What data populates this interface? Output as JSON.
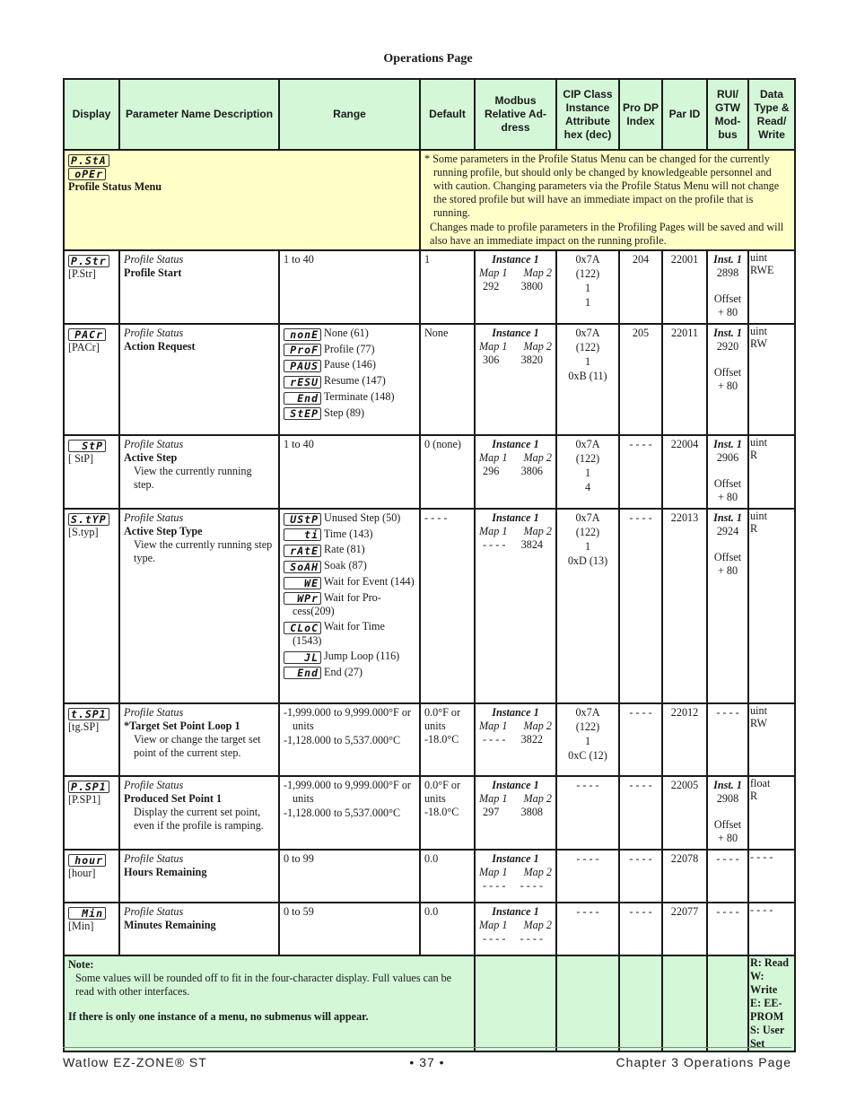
{
  "page_title": "Operations Page",
  "columns": [
    "Display",
    "Parameter Name Description",
    "Range",
    "Default",
    "Modbus Relative Ad-dress",
    "CIP Class Instance Attribute hex (dec)",
    "Pro DP Index",
    "Par ID",
    "RUI/ GTW Mod-bus",
    "Data Type & Read/ Write"
  ],
  "menu": {
    "lcd1": "P.StA",
    "lcd2": "oPEr",
    "name": "Profile Status Menu",
    "note1": "* Some parameters in the Profile Status Menu can be changed for the currently running profile, but should only be changed by knowledgeable personnel and with caution. Changing parameters via the Profile Status Menu will not change the stored profile but will have an immediate impact on the profile that is running.",
    "note2": "Changes made to profile parameters in the Profiling Pages will be saved and will also have an immediate impact on the running profile."
  },
  "rows": [
    {
      "lcd": "P.Str",
      "abbr": "[P.Str]",
      "group": "Profile Status",
      "name": "Profile Start",
      "desc": "",
      "range": [
        "1 to 40"
      ],
      "options": [],
      "default": "1",
      "modbus": {
        "instance": "Instance 1",
        "map1_label": "Map 1",
        "map2_label": "Map 2",
        "map1": "292",
        "map2": "3800"
      },
      "cip": [
        "0x7A",
        "(122)",
        "1",
        "1"
      ],
      "prodp": "204",
      "parid": "22001",
      "rui": {
        "inst": "Inst. 1",
        "value": "2898",
        "offset1": "Offset",
        "offset2": "+ 80"
      },
      "dtype": "uint",
      "rw": "RWE"
    },
    {
      "lcd": "PACr",
      "abbr": "[PACr]",
      "group": "Profile Status",
      "name": "Action Request",
      "desc": "",
      "range": [],
      "options": [
        {
          "lcd": "nonE",
          "label": "None (61)"
        },
        {
          "lcd": "ProF",
          "label": "Profile (77)"
        },
        {
          "lcd": "PAUS",
          "label": "Pause (146)"
        },
        {
          "lcd": "rESU",
          "label": "Resume (147)"
        },
        {
          "lcd": "End",
          "label": "Terminate (148)"
        },
        {
          "lcd": "StEP",
          "label": "Step (89)"
        }
      ],
      "default": "None",
      "modbus": {
        "instance": "Instance 1",
        "map1_label": "Map 1",
        "map2_label": "Map 2",
        "map1": "306",
        "map2": "3820"
      },
      "cip": [
        "0x7A",
        "(122)",
        "1",
        "0xB (11)"
      ],
      "prodp": "205",
      "parid": "22011",
      "rui": {
        "inst": "Inst. 1",
        "value": "2920",
        "offset1": "Offset",
        "offset2": "+ 80"
      },
      "dtype": "uint",
      "rw": "RW"
    },
    {
      "lcd": "StP",
      "abbr": "[ StP]",
      "group": "Profile Status",
      "name": "Active Step",
      "desc": "View the currently running step.",
      "range": [
        "1 to 40"
      ],
      "options": [],
      "default": "0 (none)",
      "modbus": {
        "instance": "Instance 1",
        "map1_label": "Map 1",
        "map2_label": "Map 2",
        "map1": "296",
        "map2": "3806"
      },
      "cip": [
        "0x7A",
        "(122)",
        "1",
        "4"
      ],
      "prodp": "- - - -",
      "parid": "22004",
      "rui": {
        "inst": "Inst. 1",
        "value": "2906",
        "offset1": "Offset",
        "offset2": "+ 80"
      },
      "dtype": "uint",
      "rw": "R"
    },
    {
      "lcd": "S.tYP",
      "abbr": "[S.typ]",
      "group": "Profile Status",
      "name": "Active Step Type",
      "desc": "View the currently running step type.",
      "range": [],
      "options": [
        {
          "lcd": "UStP",
          "label": "Unused Step (50)"
        },
        {
          "lcd": "ti",
          "label": "Time (143)"
        },
        {
          "lcd": "rAtE",
          "label": "Rate (81)"
        },
        {
          "lcd": "SoAH",
          "label": "Soak (87)"
        },
        {
          "lcd": "WE",
          "label": "Wait for Event (144)"
        },
        {
          "lcd": "WPr",
          "label": "Wait for Pro-cess(209)"
        },
        {
          "lcd": "CLoC",
          "label": "Wait for Time (1543)"
        },
        {
          "lcd": "JL",
          "label": "Jump Loop (116)"
        },
        {
          "lcd": "End",
          "label": "End (27)"
        }
      ],
      "default": "- - - -",
      "modbus": {
        "instance": "Instance 1",
        "map1_label": "Map 1",
        "map2_label": "Map 2",
        "map1": "- - - -",
        "map2": "3824"
      },
      "cip": [
        "0x7A",
        "(122)",
        "1",
        "0xD (13)"
      ],
      "prodp": "- - - -",
      "parid": "22013",
      "rui": {
        "inst": "Inst. 1",
        "value": "2924",
        "offset1": "Offset",
        "offset2": "+ 80"
      },
      "dtype": "uint",
      "rw": "R"
    },
    {
      "lcd": "t.SP1",
      "abbr": "[tg.SP]",
      "group": "Profile Status",
      "name": "*Target Set Point Loop 1",
      "desc": "View or change the target set point of the current step.",
      "range": [
        "-1,999.000 to 9,999.000°F or units",
        "-1,128.000 to 5,537.000°C"
      ],
      "options": [],
      "default": "0.0°F or units -18.0°C",
      "modbus": {
        "instance": "Instance 1",
        "map1_label": "Map 1",
        "map2_label": "Map 2",
        "map1": "- - - -",
        "map2": "3822"
      },
      "cip": [
        "0x7A",
        "(122)",
        "1",
        "0xC (12)"
      ],
      "prodp": "- - - -",
      "parid": "22012",
      "rui": {
        "inst": "",
        "value": "- - - -",
        "offset1": "",
        "offset2": ""
      },
      "dtype": "uint",
      "rw": "RW"
    },
    {
      "lcd": "P.SP1",
      "abbr": "[P.SP1]",
      "group": "Profile Status",
      "name": "Produced Set Point 1",
      "desc": "Display the current set point, even if the profile is ramping.",
      "range": [
        "-1,999.000 to 9,999.000°F or units",
        "-1,128.000 to 5,537.000°C"
      ],
      "options": [],
      "default": "0.0°F or units -18.0°C",
      "modbus": {
        "instance": "Instance 1",
        "map1_label": "Map 1",
        "map2_label": "Map 2",
        "map1": "297",
        "map2": "3808"
      },
      "cip": [
        "- - - -"
      ],
      "prodp": "- - - -",
      "parid": "22005",
      "rui": {
        "inst": "Inst. 1",
        "value": "2908",
        "offset1": "Offset",
        "offset2": "+ 80"
      },
      "dtype": "float",
      "rw": "R"
    },
    {
      "lcd": "hour",
      "abbr": "[hour]",
      "group": "Profile Status",
      "name": "Hours Remaining",
      "desc": "",
      "range": [
        "0 to 99"
      ],
      "options": [],
      "default": "0.0",
      "modbus": {
        "instance": "Instance 1",
        "map1_label": "Map 1",
        "map2_label": "Map 2",
        "map1": "- - - -",
        "map2": "- - - -"
      },
      "cip": [
        "- - - -"
      ],
      "prodp": "- - - -",
      "parid": "22078",
      "rui": {
        "inst": "",
        "value": "- - - -",
        "offset1": "",
        "offset2": ""
      },
      "dtype": "- - - -",
      "rw": ""
    },
    {
      "lcd": "Min",
      "abbr": "[Min]",
      "group": "Profile Status",
      "name": "Minutes Remaining",
      "desc": "",
      "range": [
        "0 to 59"
      ],
      "options": [],
      "default": "0.0",
      "modbus": {
        "instance": "Instance 1",
        "map1_label": "Map 1",
        "map2_label": "Map 2",
        "map1": "- - - -",
        "map2": "- - - -"
      },
      "cip": [
        "- - - -"
      ],
      "prodp": "- - - -",
      "parid": "22077",
      "rui": {
        "inst": "",
        "value": "- - - -",
        "offset1": "",
        "offset2": ""
      },
      "dtype": "- - - -",
      "rw": ""
    }
  ],
  "note": {
    "title": "Note:",
    "text": "Some values will be rounded off to fit in the four-character display. Full values can be read with other interfaces.",
    "bold": "If there is only one instance of a menu, no submenus will appear."
  },
  "legend": [
    "R: Read",
    "W: Write",
    "E: EE-PROM",
    "S: User Set"
  ],
  "footer": {
    "left": "Watlow EZ-ZONE® ST",
    "center": "•  37  •",
    "right": "Chapter 3 Operations Page"
  }
}
